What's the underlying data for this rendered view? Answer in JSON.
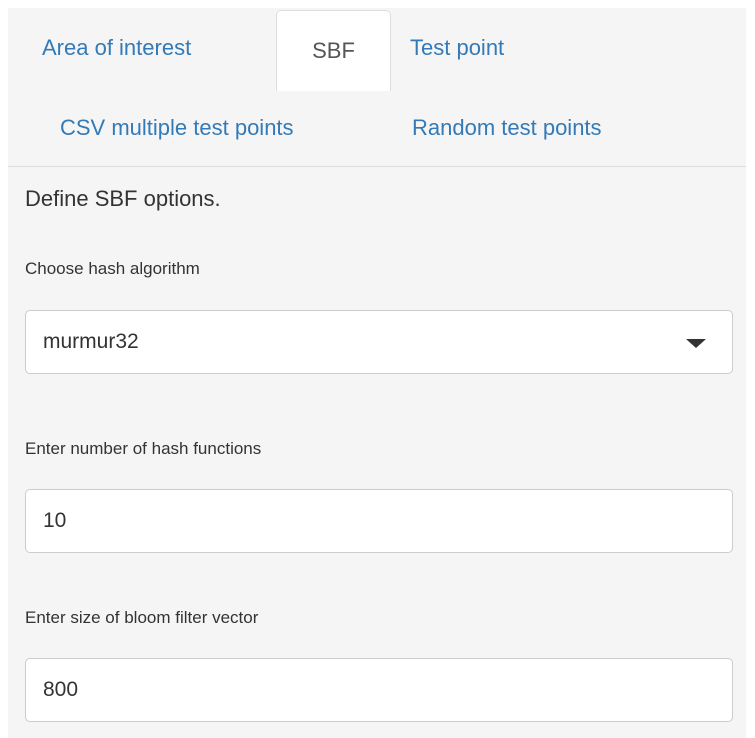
{
  "tabs": [
    {
      "label": "Area of interest",
      "active": false
    },
    {
      "label": "SBF",
      "active": true
    },
    {
      "label": "Test point",
      "active": false
    },
    {
      "label": "CSV multiple test points",
      "active": false
    },
    {
      "label": "Random test points",
      "active": false
    }
  ],
  "main": {
    "helper_text": "Define SBF options.",
    "hash_algorithm": {
      "label": "Choose hash algorithm",
      "selected": "murmur32"
    },
    "hash_functions": {
      "label": "Enter number of hash functions",
      "value": "10"
    },
    "vector_size": {
      "label": "Enter size of bloom filter vector",
      "value": "800"
    }
  },
  "colors": {
    "link": "#337ab7",
    "panel_bg": "#f5f5f5",
    "active_tab_text": "#555555",
    "text": "#333333"
  }
}
